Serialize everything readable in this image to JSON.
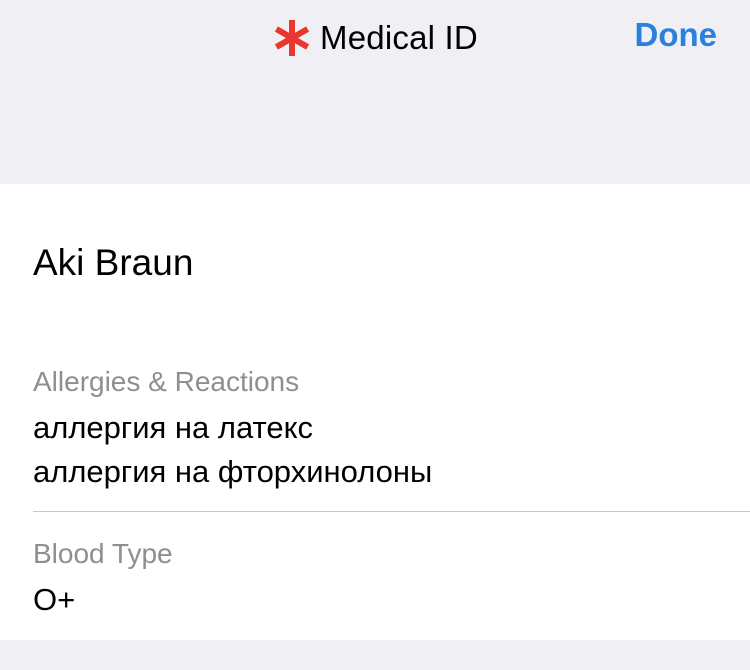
{
  "header": {
    "title": "Medical ID",
    "done_label": "Done",
    "icon": "medical-asterisk-icon",
    "accent_color": "#2a7fe0",
    "icon_color": "#e9372e"
  },
  "profile": {
    "name": "Aki Braun"
  },
  "fields": {
    "allergies": {
      "label": "Allergies & Reactions",
      "lines": [
        "аллергия на латекс",
        "аллергия на фторхинолоны"
      ]
    },
    "blood_type": {
      "label": "Blood Type",
      "value": "O+"
    }
  }
}
